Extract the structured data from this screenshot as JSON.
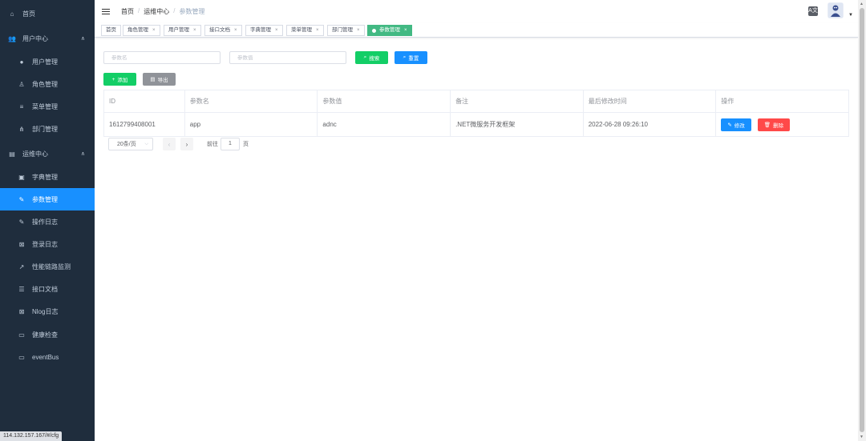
{
  "sidebar": {
    "items": [
      {
        "label": "首页",
        "icon": "dashboard-icon",
        "glyph": "⌂",
        "level": "top"
      },
      {
        "label": "用户中心",
        "icon": "users-icon",
        "glyph": "👥",
        "level": "top",
        "chevron": "∧"
      },
      {
        "label": "用户管理",
        "icon": "user-icon",
        "glyph": "●",
        "level": "sub"
      },
      {
        "label": "角色管理",
        "icon": "role-icon",
        "glyph": "♙",
        "level": "sub"
      },
      {
        "label": "菜单管理",
        "icon": "menu-icon",
        "glyph": "≡",
        "level": "sub"
      },
      {
        "label": "部门管理",
        "icon": "tree-icon",
        "glyph": "⋔",
        "level": "sub"
      },
      {
        "label": "运维中心",
        "icon": "ops-icon",
        "glyph": "▤",
        "level": "top",
        "chevron": "∧"
      },
      {
        "label": "字典管理",
        "icon": "dict-icon",
        "glyph": "▣",
        "level": "sub"
      },
      {
        "label": "参数管理",
        "icon": "wrench-icon",
        "glyph": "✎",
        "level": "sub",
        "active": true
      },
      {
        "label": "操作日志",
        "icon": "edit-log-icon",
        "glyph": "✎",
        "level": "sub"
      },
      {
        "label": "登录日志",
        "icon": "login-log-icon",
        "glyph": "⊠",
        "level": "sub"
      },
      {
        "label": "性能链路监测",
        "icon": "external-link-icon",
        "glyph": "↗",
        "level": "sub"
      },
      {
        "label": "接口文档",
        "icon": "api-doc-icon",
        "glyph": "☰",
        "level": "sub"
      },
      {
        "label": "Nlog日志",
        "icon": "nlog-icon",
        "glyph": "⊠",
        "level": "sub"
      },
      {
        "label": "健康检查",
        "icon": "monitor-icon",
        "glyph": "▭",
        "level": "sub"
      },
      {
        "label": "eventBus",
        "icon": "eventbus-icon",
        "glyph": "▭",
        "level": "sub"
      }
    ]
  },
  "status_url": "114.132.157.167/#/cfg",
  "breadcrumb": {
    "home": "首页",
    "sep": "/",
    "parent": "运维中心",
    "current": "参数管理"
  },
  "header": {
    "lang_label": "A文"
  },
  "tags": [
    {
      "label": "首页",
      "closable": false
    },
    {
      "label": "角色管理",
      "closable": true
    },
    {
      "label": "用户管理",
      "closable": true
    },
    {
      "label": "接口文档",
      "closable": true
    },
    {
      "label": "字典管理",
      "closable": true
    },
    {
      "label": "菜单管理",
      "closable": true
    },
    {
      "label": "部门管理",
      "closable": true
    },
    {
      "label": "参数管理",
      "closable": true,
      "active": true
    }
  ],
  "search": {
    "name_placeholder": "参数名",
    "value_placeholder": "参数值",
    "search_label": "搜索",
    "reset_label": "重置"
  },
  "toolbar": {
    "add_label": "添加",
    "export_label": "导出"
  },
  "table": {
    "headers": [
      "ID",
      "参数名",
      "参数值",
      "备注",
      "最后修改时间",
      "操作"
    ],
    "rows": [
      {
        "id": "1612799408001",
        "name": "app",
        "value": "adnc",
        "remark": ".NET微服务开发框架",
        "modified": "2022-06-28 09:26:10"
      }
    ],
    "edit_label": "修改",
    "delete_label": "删除"
  },
  "pagination": {
    "page_size": "20条/页",
    "goto_label": "前往",
    "page": "1",
    "page_unit": "页"
  },
  "colors": {
    "sidebar_bg": "#1f2d3d",
    "active": "#1890ff",
    "success": "#13ce66",
    "danger": "#ff4949",
    "tag_active": "#42b983"
  }
}
